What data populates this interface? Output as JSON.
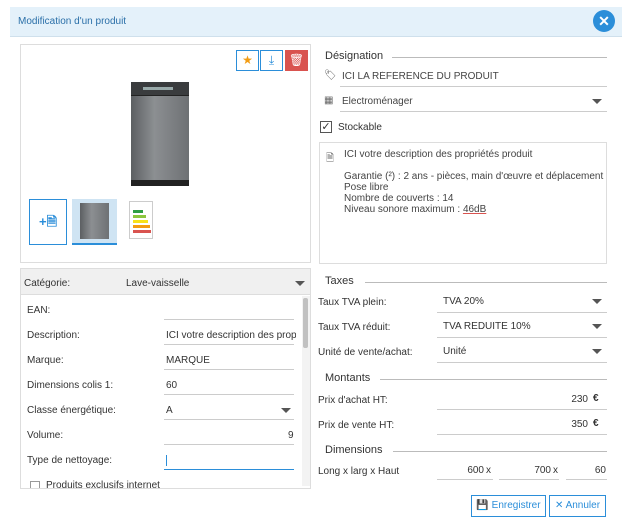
{
  "dialog": {
    "title": "Modification d'un produit"
  },
  "image_panel": {
    "add_label": "+"
  },
  "form": {
    "categorie_label": "Catégorie:",
    "categorie_value": "Lave-vaisselle",
    "fields": [
      {
        "label": "EAN:",
        "value": ""
      },
      {
        "label": "Description:",
        "value": "ICI votre description des propr"
      },
      {
        "label": "Marque:",
        "value": "MARQUE"
      },
      {
        "label": "Dimensions colis 1:",
        "value": "60"
      },
      {
        "label": "Classe énergétique:",
        "value": "A"
      },
      {
        "label": "Volume:",
        "value": "9"
      },
      {
        "label": "Type de nettoyage:",
        "value": ""
      }
    ],
    "checkbox_partial": "Produits exclusifs internet"
  },
  "designation": {
    "section_title": "Désignation",
    "reference": "ICI LA RÉFÉRENCE DU PRODUIT",
    "famille": "Electroménager",
    "stockable_label": "Stockable",
    "description_lines": [
      "ICI votre description des propriétés produit",
      "",
      "Garantie (²) : 2 ans - pièces, main d'œuvre et déplacement",
      "Pose libre",
      "Nombre de couverts : 14",
      "Niveau sonore maximum : ",
      "46dB"
    ]
  },
  "taxes": {
    "section_title": "Taxes",
    "rows": [
      {
        "label": "Taux TVA plein:",
        "value": "TVA 20%"
      },
      {
        "label": "Taux TVA réduit:",
        "value": "TVA REDUITE 10%"
      },
      {
        "label": "Unité de vente/achat:",
        "value": "Unité"
      }
    ]
  },
  "montants": {
    "section_title": "Montants",
    "rows": [
      {
        "label": "Prix d'achat HT:",
        "value": "230",
        "currency": "€"
      },
      {
        "label": "Prix de vente HT:",
        "value": "350",
        "currency": "€"
      }
    ]
  },
  "dimensions": {
    "section_title": "Dimensions",
    "label": "Long x larg x Haut",
    "long": "600",
    "larg": "700",
    "haut": "60",
    "sep": "x"
  },
  "buttons": {
    "save": "Enregistrer",
    "cancel": "Annuler"
  },
  "colors": {
    "accent": "#2b8ed9",
    "danger": "#d9534f",
    "star": "#f39c12"
  }
}
